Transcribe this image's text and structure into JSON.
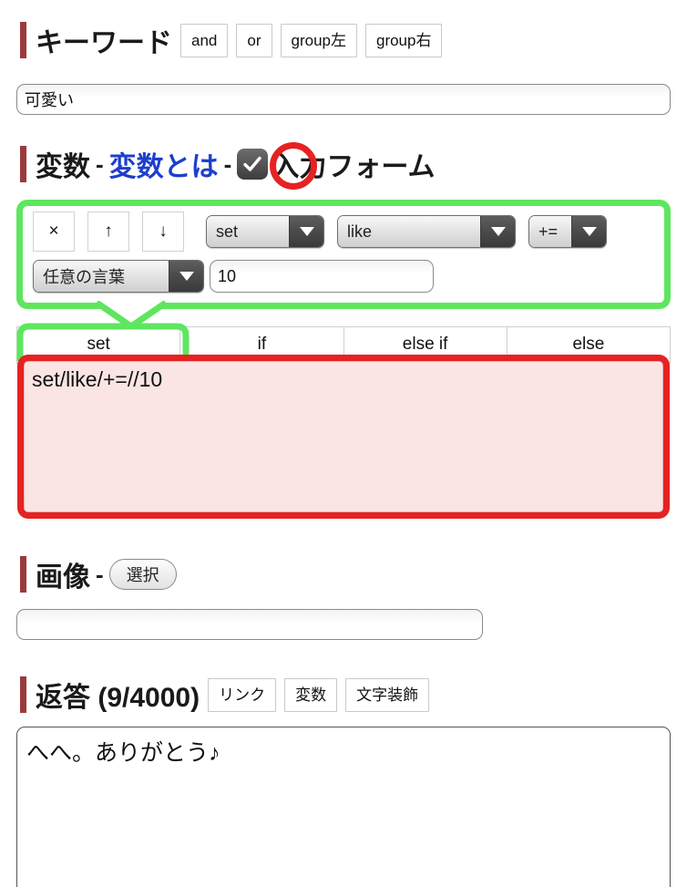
{
  "keyword": {
    "title": "キーワード",
    "buttons": [
      "and",
      "or",
      "group左",
      "group右"
    ],
    "input_value": "可愛い",
    "input_placeholder": ""
  },
  "variable": {
    "title": "変数",
    "separator": "-",
    "link_label": "変数とは",
    "separator2": "-",
    "form_label": "入力フォーム",
    "checkbox_checked": true,
    "row_buttons": {
      "remove": "×",
      "up": "↑",
      "down": "↓"
    },
    "selects": {
      "command": "set",
      "variable_name": "like",
      "operator": "+=",
      "value_type": "任意の言葉"
    },
    "value_input": "10",
    "value_placeholder": "",
    "tabs": [
      "set",
      "if",
      "else if",
      "else"
    ],
    "active_tab": "set",
    "code_value": "set/like/+=//10"
  },
  "image": {
    "title": "画像",
    "separator": "-",
    "select_button": "選択",
    "input_value": "",
    "input_placeholder": ""
  },
  "reply": {
    "title": "返答 (9/4000)",
    "buttons": [
      "リンク",
      "変数",
      "文字装飾"
    ],
    "textarea_value": "へへ。ありがとう♪",
    "textarea_placeholder": ""
  },
  "colors": {
    "heading_bar": "#9b3a3a",
    "link_blue": "#1d3fcc",
    "highlight_green": "#5ee65e",
    "highlight_red": "#e62222",
    "code_bg": "#fae4e4"
  }
}
